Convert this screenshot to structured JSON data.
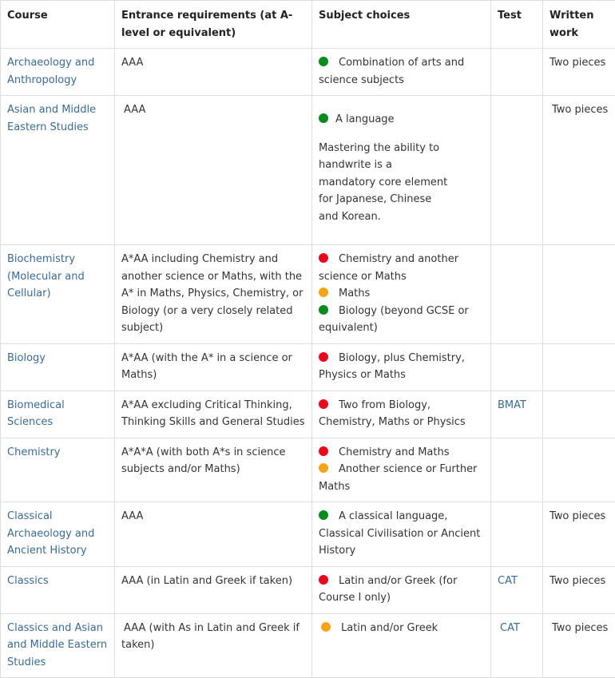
{
  "colors": {
    "green": "#0b8a1d",
    "red": "#e8081e",
    "amber": "#f2a519",
    "link": "#3a6a94"
  },
  "headers": [
    "Course",
    "Entrance requirements (at A-level or equivalent)",
    "Subject choices",
    "Test",
    "Written work"
  ],
  "rows": [
    {
      "course": "Archaeology and Anthropology",
      "entrance": "AAA",
      "choices": [
        {
          "dot": "green",
          "text": "Combination of arts and science subjects"
        }
      ],
      "test": "",
      "written": "Two pieces"
    },
    {
      "course": "Asian and Middle Eastern Studies",
      "entrance": "AAA",
      "choices": [
        {
          "dot": "green",
          "text": "A language"
        }
      ],
      "note": "Mastering the ability to handwrite is a mandatory core element for Japanese, Chinese and Korean.",
      "test": "",
      "written": "Two pieces"
    },
    {
      "course": "Biochemistry (Molecular and Cellular)",
      "entrance": "A*AA including Chemistry and another science or Maths, with the A* in Maths, Physics, Chemistry, or Biology (or a very closely related subject)",
      "choices": [
        {
          "dot": "red",
          "text": "Chemistry and another science or Maths"
        },
        {
          "dot": "amber",
          "text": "Maths"
        },
        {
          "dot": "green",
          "text": "Biology (beyond GCSE or equivalent)"
        }
      ],
      "test": "",
      "written": ""
    },
    {
      "course": "Biology",
      "entrance": "A*AA (with the A* in a science or Maths)",
      "choices": [
        {
          "dot": "red",
          "text": "Biology, plus Chemistry, Physics or Maths"
        }
      ],
      "test": "",
      "written": ""
    },
    {
      "course": "Biomedical Sciences",
      "entrance": "A*AA excluding Critical Thinking, Thinking Skills and General Studies",
      "choices": [
        {
          "dot": "red",
          "text": "Two from Biology, Chemistry, Maths or Physics"
        }
      ],
      "test": "BMAT",
      "written": ""
    },
    {
      "course": "Chemistry",
      "entrance": "A*A*A (with both A*s in science subjects and/or Maths)",
      "choices": [
        {
          "dot": "red",
          "text": "Chemistry and Maths"
        },
        {
          "dot": "amber",
          "text": "Another science or Further Maths"
        }
      ],
      "test": "",
      "written": ""
    },
    {
      "course": "Classical Archaeology and Ancient History",
      "entrance": "AAA",
      "choices": [
        {
          "dot": "green",
          "text": "A classical language, Classical Civilisation or Ancient History"
        }
      ],
      "test": "",
      "written": "Two pieces"
    },
    {
      "course": "Classics",
      "entrance": "AAA (in Latin and Greek if taken)",
      "choices": [
        {
          "dot": "red",
          "text": "Latin and/or Greek (for Course I only)"
        }
      ],
      "test": "CAT",
      "written": "Two pieces"
    },
    {
      "course": "Classics and Asian and Middle Eastern Studies",
      "entrance": "AAA (with As in Latin and Greek if taken)",
      "choices": [
        {
          "dot": "amber",
          "text": "Latin and/or Greek"
        }
      ],
      "test": "CAT",
      "written": "Two pieces"
    }
  ]
}
